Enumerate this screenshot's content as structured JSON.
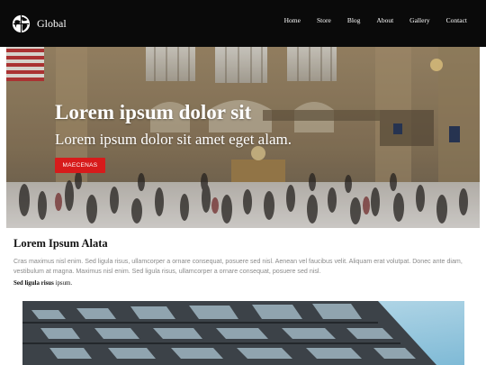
{
  "site": {
    "brand_name": "Global",
    "brand_icon": "globe-icon"
  },
  "nav": {
    "items": [
      "Home",
      "Store",
      "Blog",
      "About",
      "Gallery",
      "Contact"
    ]
  },
  "hero": {
    "title": "Lorem ipsum dolor sit",
    "subtitle": "Lorem ipsum dolor sit amet eget alam.",
    "button_label": "MAECENAS",
    "button_color": "#d71b1b"
  },
  "content": {
    "title": "Lorem Ipsum Alata",
    "body": "Cras maximus nisl enim. Sed ligula risus, ullamcorper a ornare consequat, posuere sed nisl. Aenean vel faucibus velit. Aliquam erat volutpat. Donec ante diam, vestibulum at magna. Maximus nisl enim. Sed ligula risus, ullamcorper a ornare consequat, posuere sed nisl.",
    "note_bold": "Sed ligula risus",
    "note_rest": " ipsum."
  }
}
